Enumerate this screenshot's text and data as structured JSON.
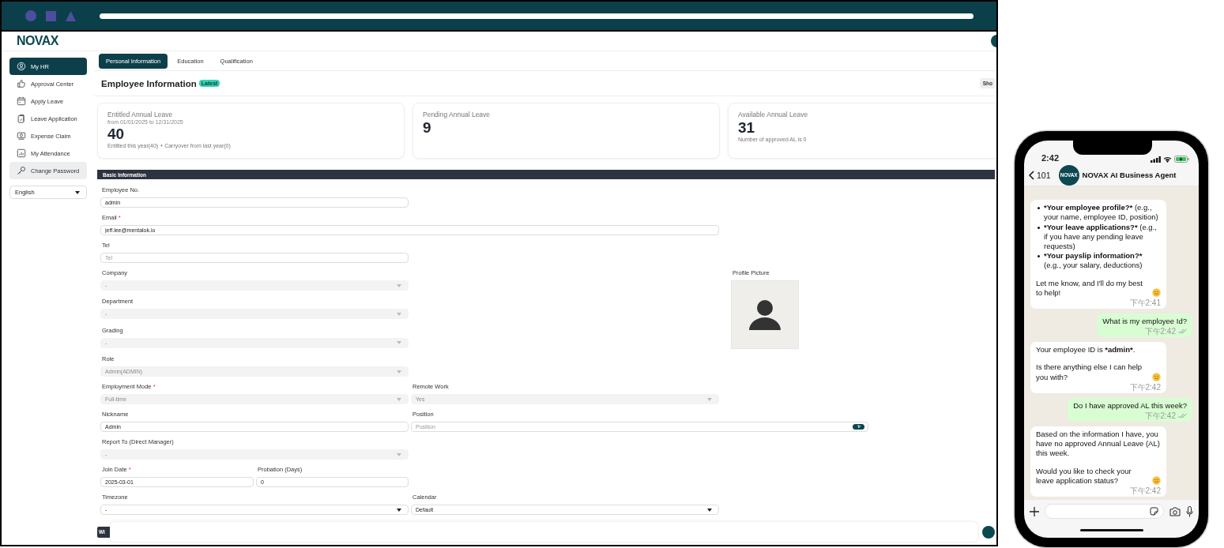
{
  "app": {
    "logo": "NOVAX"
  },
  "sidebar": {
    "items": [
      {
        "label": "My HR",
        "selected": true,
        "hovered": false
      },
      {
        "label": "Approval Center",
        "selected": false,
        "hovered": false
      },
      {
        "label": "Apply Leave",
        "selected": false,
        "hovered": false
      },
      {
        "label": "Leave Application",
        "selected": false,
        "hovered": false
      },
      {
        "label": "Expense Claim",
        "selected": false,
        "hovered": false
      },
      {
        "label": "My Attendance",
        "selected": false,
        "hovered": false
      },
      {
        "label": "Change Password",
        "selected": false,
        "hovered": true
      }
    ],
    "language": "English"
  },
  "tabs": [
    {
      "label": "Personal Information",
      "selected": true
    },
    {
      "label": "Education",
      "selected": false
    },
    {
      "label": "Qualification",
      "selected": false
    }
  ],
  "page_title": "Employee Information",
  "title_badge": "Latest",
  "header_button": "Sho",
  "cards": [
    {
      "title": "Entitled Annual Leave",
      "subtitle": "from 01/01/2025 to 12/31/2025",
      "value": "40",
      "note": "Entitled this year(40) + Carryover from last year(0)"
    },
    {
      "title": "Pending Annual Leave",
      "value": "9"
    },
    {
      "title": "Available Annual Leave",
      "value": "31",
      "note": "Number of approved AL is 0"
    }
  ],
  "section": "Basic Information",
  "form": {
    "rows": [
      [
        {
          "label": "Employee No.",
          "kind": "text",
          "value": "admin"
        }
      ],
      [
        {
          "label": "Email",
          "required_mark": "*",
          "kind": "text",
          "value": "jeff.lee@mentalok.io"
        }
      ],
      [
        {
          "label": "Tel",
          "kind": "text",
          "placeholder": "Tel"
        }
      ],
      [
        {
          "label": "Company",
          "kind": "select",
          "value": "-",
          "disabled": true
        }
      ],
      [
        {
          "label": "Department",
          "kind": "select",
          "value": "-",
          "disabled": true
        }
      ],
      [
        {
          "label": "Grading",
          "kind": "select",
          "value": "-",
          "disabled": true
        }
      ],
      [
        {
          "label": "Role",
          "kind": "select",
          "value": "Admin(ADMIN)",
          "disabled": true
        }
      ],
      [
        {
          "label": "Employment Mode",
          "required_mark": "*",
          "kind": "select",
          "value": "Full-time",
          "disabled": true
        },
        {
          "label": "Remote Work",
          "kind": "select",
          "value": "Yes",
          "disabled": true
        }
      ],
      [
        {
          "label": "Nickname",
          "kind": "text",
          "value": "Admin"
        },
        {
          "label": "Position",
          "kind": "text_action",
          "placeholder": "Position"
        }
      ],
      [
        {
          "label": "Report To (Direct Manager)",
          "kind": "select",
          "value": "-",
          "disabled": true
        }
      ],
      [
        {
          "label": "Join Date",
          "required_mark": "*",
          "kind": "text",
          "value": "2025-03-01"
        },
        {
          "label": "Probation (Days)",
          "kind": "text",
          "value": "0"
        }
      ],
      [
        {
          "label": "Timezone",
          "kind": "select",
          "value": "-",
          "disabled": false
        },
        {
          "label": "Calendar",
          "kind": "select",
          "value": "Default",
          "disabled": false
        }
      ]
    ],
    "profile_picture": {
      "label": "Profile Picture"
    }
  },
  "next_section": "Wi",
  "phone": {
    "time": "2:42",
    "back_count": "101",
    "avatar_text": "NOVAX",
    "contact": "NOVAX AI Business Agent",
    "messages": [
      {
        "kind": "incoming",
        "blocks": [
          {
            "kind": "bullet",
            "parts": [
              {
                "text": "*Your employee profile?*",
                "bold": true
              },
              {
                "text": " (e.g., your name, employee ID, position)",
                "bold": false
              }
            ],
            "emoji": false
          },
          {
            "kind": "bullet",
            "parts": [
              {
                "text": "*Your leave applications?*",
                "bold": true
              },
              {
                "text": " (e.g., if you have any pending leave requests)",
                "bold": false
              }
            ],
            "emoji": false
          },
          {
            "kind": "bullet",
            "parts": [
              {
                "text": "*Your payslip information?*",
                "bold": true
              },
              {
                "text": " (e.g., your salary, deductions)",
                "bold": false
              }
            ],
            "emoji": false
          },
          {
            "kind": "para",
            "parts": [
              {
                "text": "Let me know, and I'll do my best to help!",
                "bold": false
              }
            ],
            "emoji": true
          }
        ],
        "time": "下午2:41"
      },
      {
        "kind": "outgoing",
        "blocks": [
          {
            "kind": "para",
            "parts": [
              {
                "text": "What is my employee Id?",
                "bold": false
              }
            ],
            "emoji": false
          }
        ],
        "time": "下午2:42"
      },
      {
        "kind": "incoming",
        "blocks": [
          {
            "kind": "para",
            "parts": [
              {
                "text": "Your employee ID is ",
                "bold": false
              },
              {
                "text": "*admin*",
                "bold": true
              },
              {
                "text": ".",
                "bold": false
              }
            ],
            "emoji": false
          },
          {
            "kind": "para",
            "parts": [
              {
                "text": "Is there anything else I can help you with?",
                "bold": false
              }
            ],
            "emoji": true
          }
        ],
        "time": "下午2:42"
      },
      {
        "kind": "outgoing",
        "blocks": [
          {
            "kind": "para",
            "parts": [
              {
                "text": "Do I have approved AL this week?",
                "bold": false
              }
            ],
            "emoji": false
          }
        ],
        "time": "下午2:42"
      },
      {
        "kind": "incoming",
        "blocks": [
          {
            "kind": "para",
            "parts": [
              {
                "text": "Based on the information I have, you have no approved Annual Leave (AL) this week.",
                "bold": false
              }
            ],
            "emoji": false
          },
          {
            "kind": "para",
            "parts": [
              {
                "text": "Would you like to check your leave application status?",
                "bold": false
              }
            ],
            "emoji": true
          }
        ],
        "time": "下午2:42"
      }
    ]
  }
}
